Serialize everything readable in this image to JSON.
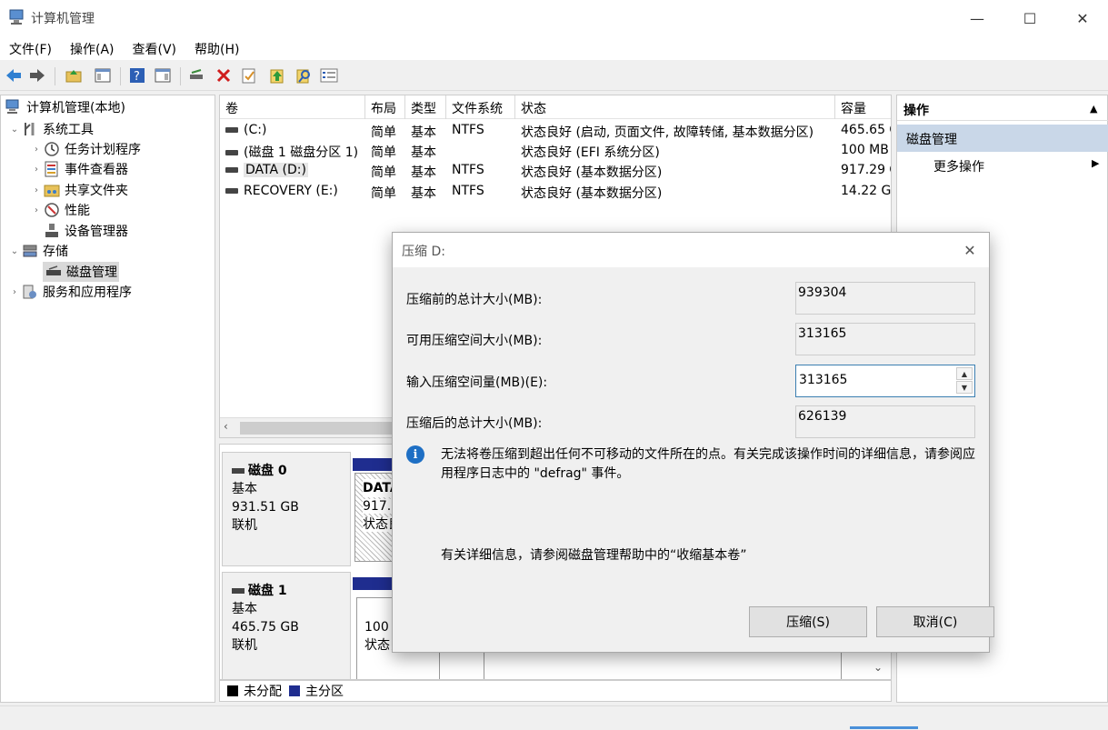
{
  "window": {
    "title": "计算机管理",
    "minimize": "—",
    "maximize": "☐",
    "close": "✕"
  },
  "menu": [
    "文件(F)",
    "操作(A)",
    "查看(V)",
    "帮助(H)"
  ],
  "tree": {
    "root": "计算机管理(本地)",
    "system_tools": "系统工具",
    "task_scheduler": "任务计划程序",
    "event_viewer": "事件查看器",
    "shared_folders": "共享文件夹",
    "performance": "性能",
    "device_manager": "设备管理器",
    "storage": "存储",
    "disk_management": "磁盘管理",
    "services_apps": "服务和应用程序"
  },
  "volume_list": {
    "columns": [
      "卷",
      "布局",
      "类型",
      "文件系统",
      "状态",
      "容量"
    ],
    "rows": [
      {
        "volume": "(C:)",
        "layout": "简单",
        "type": "基本",
        "fs": "NTFS",
        "status": "状态良好 (启动, 页面文件, 故障转储, 基本数据分区)",
        "capacity": "465.65 G"
      },
      {
        "volume": "(磁盘 1 磁盘分区 1)",
        "layout": "简单",
        "type": "基本",
        "fs": "",
        "status": "状态良好 (EFI 系统分区)",
        "capacity": "100 MB"
      },
      {
        "volume": "DATA (D:)",
        "layout": "简单",
        "type": "基本",
        "fs": "NTFS",
        "status": "状态良好 (基本数据分区)",
        "capacity": "917.29 G"
      },
      {
        "volume": "RECOVERY (E:)",
        "layout": "简单",
        "type": "基本",
        "fs": "NTFS",
        "status": "状态良好 (基本数据分区)",
        "capacity": "14.22 G"
      }
    ]
  },
  "disk_map": {
    "disk0": {
      "name": "磁盘 0",
      "type": "基本",
      "size": "931.51 GB",
      "state": "联机",
      "part_name": "DATA",
      "part_size": "917.2",
      "part_status": "状态良"
    },
    "disk1": {
      "name": "磁盘 1",
      "type": "基本",
      "size": "465.75 GB",
      "state": "联机",
      "part_size": "100 M",
      "part_status": "状态良"
    }
  },
  "legend": {
    "unallocated": "未分配",
    "primary": "主分区",
    "unallocated_color": "#000000",
    "primary_color": "#1f2d8f"
  },
  "actions": {
    "title": "操作",
    "section": "磁盘管理",
    "more": "更多操作"
  },
  "dialog": {
    "title": "压缩 D:",
    "total_before_label": "压缩前的总计大小(MB):",
    "total_before_value": "939304",
    "available_label": "可用压缩空间大小(MB):",
    "available_value": "313165",
    "input_label": "输入压缩空间量(MB)(E):",
    "input_value": "313165",
    "total_after_label": "压缩后的总计大小(MB):",
    "total_after_value": "626139",
    "info_text": "无法将卷压缩到超出任何不可移动的文件所在的点。有关完成该操作时间的详细信息，请参阅应用程序日志中的 \"defrag\" 事件。",
    "more_info": "有关详细信息，请参阅磁盘管理帮助中的“收缩基本卷”",
    "shrink_button": "压缩(S)",
    "cancel_button": "取消(C)"
  }
}
